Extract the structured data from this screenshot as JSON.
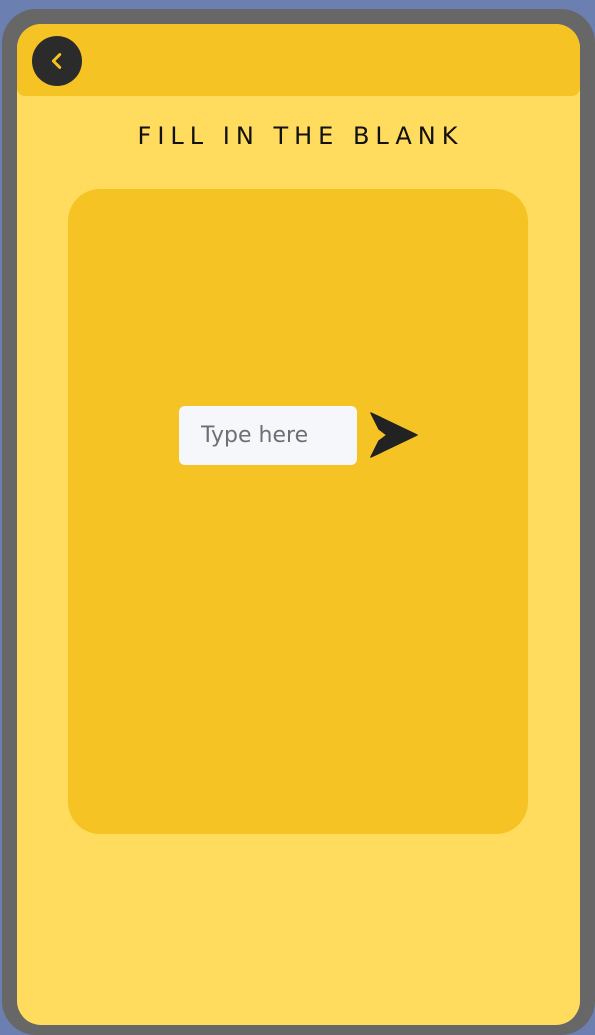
{
  "header": {
    "back_icon": "chevron-left-icon"
  },
  "title": "FILL IN THE BLANK",
  "answer": {
    "placeholder": "Type here",
    "value": ""
  },
  "send": {
    "icon": "send-arrow-icon"
  },
  "colors": {
    "background": "#6b7fb0",
    "frame": "#676767",
    "screen": "#ffdb5e",
    "top_bar": "#f6c325",
    "card": "#f5c324",
    "dark": "#2b2b2b",
    "accent": "#f6c325"
  }
}
